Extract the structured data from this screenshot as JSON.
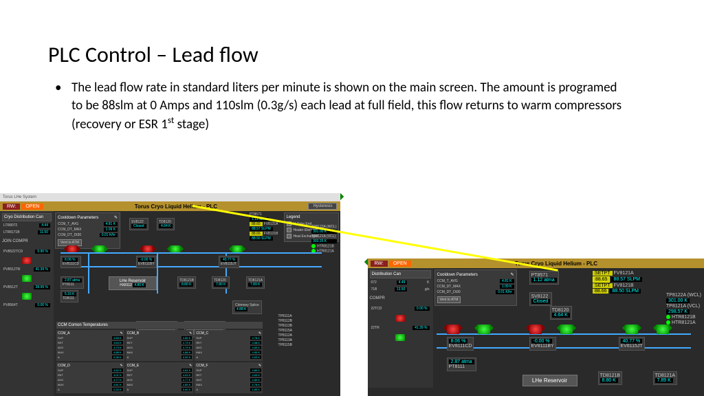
{
  "slide": {
    "title": "PLC Control – Lead flow",
    "bullet_html": "The  lead flow rate in standard liters per minute is shown on the main screen. The amount is programed to be 88slm at 0 Amps and 110slm (0.3g/s) each lead at full field, this flow returns to warm compressors (recovery or ESR 1<sup>st</sup> stage)"
  },
  "left": {
    "window_title": "Torus LHe System",
    "header_title": "Torus Cryo Liquid Helium - PLC",
    "rw": "RW:",
    "open": "OPEN",
    "hyd": "Hysteresis",
    "sidebar": {
      "cap": "Cryo Distribution Can",
      "rows": [
        [
          "LTR8072",
          "4.44",
          "K"
        ],
        [
          "LTR8171B",
          "11.50",
          "g/s"
        ]
      ],
      "join": "JOIN COMPR",
      "ev_rows": [
        [
          "PV8522TCD",
          "0.90 %"
        ],
        [
          "PV8512TR",
          "41.39 %"
        ],
        [
          "PV8512T",
          "28.99 %"
        ],
        [
          "PV8564T",
          "0.00 %"
        ]
      ]
    },
    "cooldown": {
      "title": "Cooldown Parameters",
      "rows": [
        [
          "CCM_T_AVG",
          "4.81 K"
        ],
        [
          "CCM_DT_MAX",
          "1.09 K"
        ],
        [
          "CCM_DT_Dt30",
          "0.01 K/hr"
        ]
      ],
      "vent": "Vent to ATM"
    },
    "legend": {
      "title": "Legend",
      "items": [
        "U-Tube End",
        "Heater Element",
        "Heat Exchanger"
      ]
    },
    "fv": [
      {
        "l": "FV8121A",
        "y": "88.65",
        "v": "88.57 SLPM"
      },
      {
        "l": "FV8121B",
        "y": "88.66",
        "v": "88.50 SLPM"
      }
    ],
    "pt": [
      {
        "l": "PT8571",
        "v": "1.12 atma"
      }
    ],
    "sv": [
      {
        "l": "SV8122",
        "v": "Closed"
      },
      {
        "l": "TD8120",
        "v": "4.64 K"
      }
    ],
    "pct": [
      [
        "8.06 %",
        "EV8111CD"
      ],
      [
        "-0.00 %",
        "EV8111BY"
      ],
      [
        "40.77 %",
        "EV8115JT"
      ]
    ],
    "lhe": {
      "t": "LHe Reservoir",
      "r": [
        [
          "HX8112",
          "4.80 K"
        ]
      ]
    },
    "td": [
      [
        "TD8121B",
        "8.80 K"
      ],
      [
        "TD8120",
        "7.80 K"
      ],
      [
        "TD8121A",
        "7.89 K"
      ]
    ],
    "tplist": [
      "TP8122A (WCL)",
      "301.00 K",
      "TP8121A (VCL)",
      "303.25 K",
      "HTR8121B",
      "HTR8121A"
    ],
    "temps": {
      "title": "CCM Comon Temperatures",
      "cols": [
        {
          "n": "CCM_A",
          "r": [
            [
              "SUP",
              "4.85 K"
            ],
            [
              "RET",
              "3.84 K"
            ],
            [
              "AVG",
              "4.79 K"
            ],
            [
              "MAX",
              "4.88 K"
            ],
            [
              "Δ",
              "0.36 K"
            ]
          ]
        },
        {
          "n": "CCM_B",
          "r": [
            [
              "SUP",
              "4.86 K"
            ],
            [
              "RET",
              "4.73 K"
            ],
            [
              "AVG",
              "4.79 K"
            ],
            [
              "MAX",
              "4.88 K"
            ],
            [
              "Δ",
              "0.59 K"
            ]
          ]
        },
        {
          "n": "CCM_C",
          "r": [
            [
              "SUP",
              "4.78 K"
            ],
            [
              "RET",
              "4.58 K"
            ],
            [
              "AVG",
              "4.83 K"
            ],
            [
              "MAX",
              "4.90 K"
            ],
            [
              "Δ",
              "0.63 K"
            ]
          ]
        },
        {
          "n": "CCM_D",
          "r": [
            [
              "SUP",
              "4.82 K"
            ],
            [
              "RET",
              "4.01 K"
            ],
            [
              "AVG",
              "4.77 K"
            ],
            [
              "MAX",
              "4.81 K"
            ],
            [
              "Δ",
              "0.20 K"
            ]
          ]
        },
        {
          "n": "CCM_E",
          "r": [
            [
              "SUP",
              "4.81 K"
            ],
            [
              "RET",
              "4.63 K"
            ],
            [
              "AVG",
              "4.77 K"
            ],
            [
              "MAX",
              "4.85 K"
            ],
            [
              "Δ",
              "0.60 K"
            ]
          ]
        },
        {
          "n": "CCM_F",
          "r": [
            [
              "SUP",
              "4.80 K"
            ],
            [
              "RET",
              "4.63 K"
            ],
            [
              "AVG",
              "4.80 K"
            ],
            [
              "MAX",
              "5.78 K"
            ],
            [
              "Δ",
              "1.85 K"
            ]
          ]
        }
      ]
    },
    "extra": [
      [
        "2.87 atma",
        "PT8111"
      ],
      [
        "5.15 K",
        "TD8111"
      ]
    ],
    "chimney": {
      "t": "Chimney Splice",
      "v": "4.88 K"
    },
    "tp_right": [
      "TP8111A",
      "TP8112B",
      "TP8113B",
      "TP8115A",
      "TP8112A",
      "TP8113A",
      "TP8115B"
    ]
  },
  "right": {
    "header_title": "Torus Cryo Liquid Helium - PLC",
    "rw": "RW:",
    "open": "OPEN",
    "sidebar": {
      "cap": "Distribution Can",
      "rows": [
        [
          "072",
          "4.49",
          "K"
        ],
        [
          "71B",
          "13.50",
          "g/s"
        ]
      ],
      "compr": "COMPR",
      "ev": [
        [
          "22TCD",
          "0.00 %"
        ],
        [
          "22TR",
          "41.39 %"
        ]
      ]
    },
    "cooldown": {
      "title": "Cooldown Parameters",
      "rows": [
        [
          "CCM_T_AVG",
          "4.81 K"
        ],
        [
          "CCM_DT_MAX",
          "1.09 K"
        ],
        [
          "CCM_DT_Dt30",
          "0.01 K/hr"
        ]
      ],
      "vent": "Vent to ATM"
    },
    "fv": [
      {
        "l": "FV8121A",
        "y": "SETPT",
        "v": "88.57 SLPM",
        "hl": "88.65"
      },
      {
        "l": "FV8121B",
        "y": "SETPT",
        "v": "88.50 SLPM",
        "hl": "88.66"
      }
    ],
    "pt": {
      "l": "PT8571",
      "v": "1.12 atma"
    },
    "sv": {
      "l": "SV8122",
      "v": "Closed"
    },
    "td": {
      "l": "TD8120",
      "v": "4.64 K"
    },
    "pct": [
      [
        "8.06 %",
        "EV8111CD"
      ],
      [
        "-0.00 %",
        "EV8111BY"
      ],
      [
        "40.77 %",
        "EV8115JT"
      ]
    ],
    "extra": [
      [
        "2.87 atma",
        "PT8111"
      ]
    ],
    "tdright": [
      [
        "TD8121B",
        "8.80 K"
      ],
      [
        "TD8121A",
        "7.89 K"
      ]
    ],
    "tplist": [
      [
        "TP8122A (WCL)",
        "301.00 K"
      ],
      [
        "TP8121A (VCL)",
        "298.57 K"
      ],
      [
        "HTR8121B",
        ""
      ],
      [
        "HTR8121A",
        ""
      ]
    ],
    "lhe": "LHe Reservoir"
  }
}
